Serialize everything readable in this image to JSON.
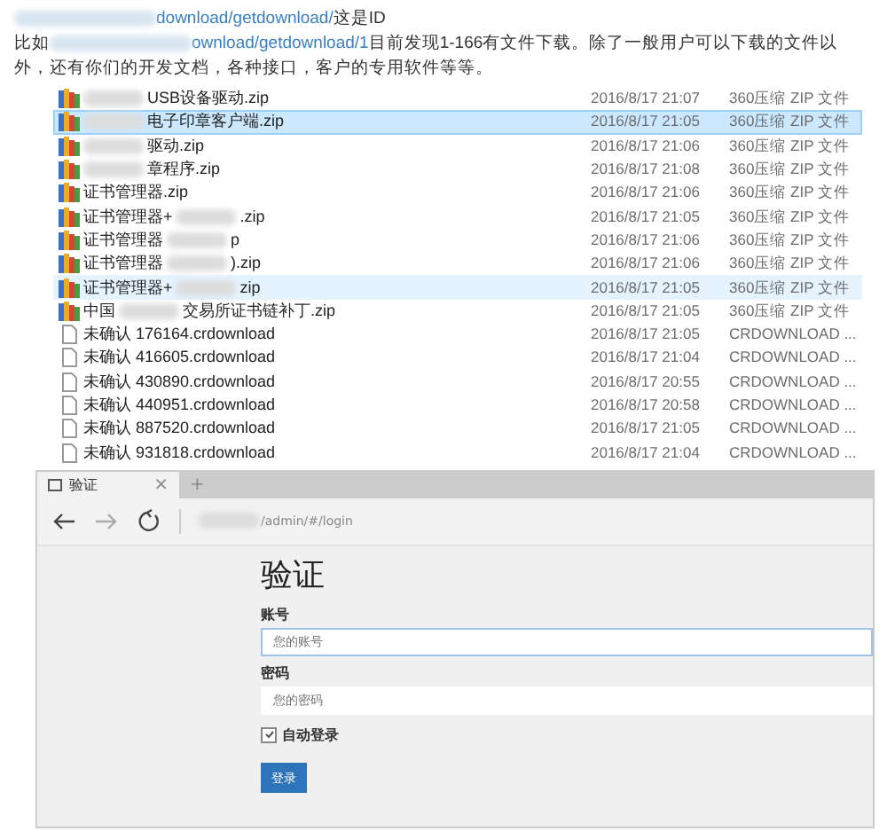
{
  "intro_lines": [
    [
      {
        "kind": "blur"
      },
      {
        "kind": "link",
        "text": "download/getdownload/"
      },
      {
        "kind": "text",
        "text": "这是ID"
      }
    ],
    [
      {
        "kind": "text",
        "text": "比如"
      },
      {
        "kind": "blur"
      },
      {
        "kind": "link",
        "text": "ownload/getdownload/1"
      },
      {
        "kind": "text",
        "text": "目前发现1-166有文件下载。除了一般用户可以下载的文件以"
      }
    ],
    [
      {
        "kind": "text",
        "text": "外，还有你们的开发文档，各种接口，客户的专用软件等等。"
      }
    ]
  ],
  "files": [
    {
      "kind": "zip",
      "selected": false,
      "hovered": false,
      "name": [
        {
          "kind": "blur"
        },
        {
          "kind": "text",
          "text": "USB设备驱动.zip"
        }
      ],
      "date": "2016/8/17 21:07",
      "type": "360压缩 ZIP 文件"
    },
    {
      "kind": "zip",
      "selected": true,
      "hovered": false,
      "name": [
        {
          "kind": "blur"
        },
        {
          "kind": "text",
          "text": "电子印章客户端.zip"
        }
      ],
      "date": "2016/8/17 21:05",
      "type": "360压缩 ZIP 文件"
    },
    {
      "kind": "zip",
      "selected": false,
      "hovered": false,
      "name": [
        {
          "kind": "blur"
        },
        {
          "kind": "text",
          "text": "驱动.zip"
        }
      ],
      "date": "2016/8/17 21:06",
      "type": "360压缩 ZIP 文件"
    },
    {
      "kind": "zip",
      "selected": false,
      "hovered": false,
      "name": [
        {
          "kind": "blur"
        },
        {
          "kind": "text",
          "text": "章程序.zip"
        }
      ],
      "date": "2016/8/17 21:08",
      "type": "360压缩 ZIP 文件"
    },
    {
      "kind": "zip",
      "selected": false,
      "hovered": false,
      "name": [
        {
          "kind": "text",
          "text": "证书管理器.zip"
        }
      ],
      "date": "2016/8/17 21:06",
      "type": "360压缩 ZIP 文件"
    },
    {
      "kind": "zip",
      "selected": false,
      "hovered": false,
      "name": [
        {
          "kind": "text",
          "text": "证书管理器+"
        },
        {
          "kind": "blur"
        },
        {
          "kind": "text",
          "text": ".zip"
        }
      ],
      "date": "2016/8/17 21:05",
      "type": "360压缩 ZIP 文件"
    },
    {
      "kind": "zip",
      "selected": false,
      "hovered": false,
      "name": [
        {
          "kind": "text",
          "text": "证书管理器"
        },
        {
          "kind": "blur"
        },
        {
          "kind": "text",
          "text": "p"
        }
      ],
      "date": "2016/8/17 21:06",
      "type": "360压缩 ZIP 文件"
    },
    {
      "kind": "zip",
      "selected": false,
      "hovered": false,
      "name": [
        {
          "kind": "text",
          "text": "证书管理器"
        },
        {
          "kind": "blur"
        },
        {
          "kind": "text",
          "text": ").zip"
        }
      ],
      "date": "2016/8/17 21:06",
      "type": "360压缩 ZIP 文件"
    },
    {
      "kind": "zip",
      "selected": false,
      "hovered": true,
      "name": [
        {
          "kind": "text",
          "text": "证书管理器+"
        },
        {
          "kind": "blur"
        },
        {
          "kind": "text",
          "text": "zip"
        }
      ],
      "date": "2016/8/17 21:05",
      "type": "360压缩 ZIP 文件"
    },
    {
      "kind": "zip",
      "selected": false,
      "hovered": false,
      "name": [
        {
          "kind": "text",
          "text": "中国"
        },
        {
          "kind": "blur"
        },
        {
          "kind": "text",
          "text": "交易所证书链补丁.zip"
        }
      ],
      "date": "2016/8/17 21:05",
      "type": "360压缩 ZIP 文件"
    },
    {
      "kind": "file",
      "selected": false,
      "hovered": false,
      "name": [
        {
          "kind": "text",
          "text": "未确认 176164.crdownload"
        }
      ],
      "date": "2016/8/17 21:05",
      "type": "CRDOWNLOAD ..."
    },
    {
      "kind": "file",
      "selected": false,
      "hovered": false,
      "name": [
        {
          "kind": "text",
          "text": "未确认 416605.crdownload"
        }
      ],
      "date": "2016/8/17 21:04",
      "type": "CRDOWNLOAD ..."
    },
    {
      "kind": "file",
      "selected": false,
      "hovered": false,
      "name": [
        {
          "kind": "text",
          "text": "未确认 430890.crdownload"
        }
      ],
      "date": "2016/8/17 20:55",
      "type": "CRDOWNLOAD ..."
    },
    {
      "kind": "file",
      "selected": false,
      "hovered": false,
      "name": [
        {
          "kind": "text",
          "text": "未确认 440951.crdownload"
        }
      ],
      "date": "2016/8/17 20:58",
      "type": "CRDOWNLOAD ..."
    },
    {
      "kind": "file",
      "selected": false,
      "hovered": false,
      "name": [
        {
          "kind": "text",
          "text": "未确认 887520.crdownload"
        }
      ],
      "date": "2016/8/17 21:05",
      "type": "CRDOWNLOAD ..."
    },
    {
      "kind": "file",
      "selected": false,
      "hovered": false,
      "name": [
        {
          "kind": "text",
          "text": "未确认 931818.crdownload"
        }
      ],
      "date": "2016/8/17 21:04",
      "type": "CRDOWNLOAD ..."
    }
  ],
  "browser": {
    "tab": {
      "title": "验证",
      "close": "×"
    },
    "new_tab": "+",
    "address": "/admin/#/login",
    "page": {
      "title": "验证",
      "fields": [
        {
          "label": "账号",
          "placeholder": "您的账号",
          "focused": true
        },
        {
          "label": "密码",
          "placeholder": "您的密码",
          "focused": false
        }
      ],
      "remember": {
        "label": "自动登录",
        "checked": true
      },
      "submit": "登录"
    }
  }
}
